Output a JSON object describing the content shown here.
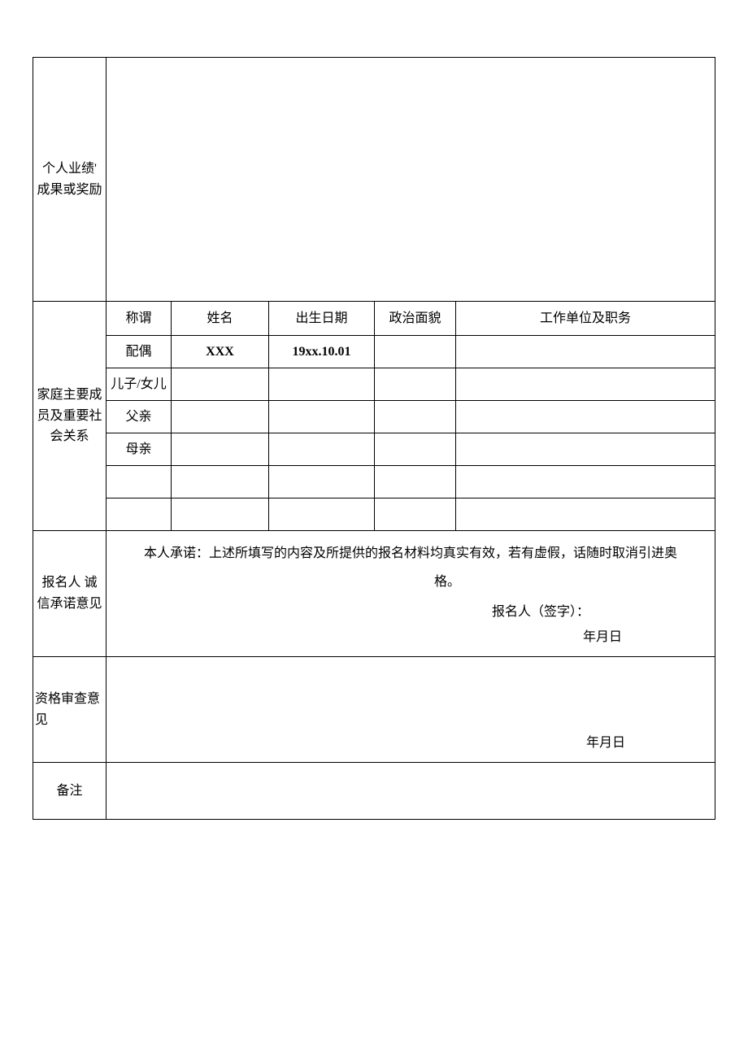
{
  "sections": {
    "achievements_label": "个人业绩' 成果或奖励",
    "family_label": "家庭主要成员及重要社会关系",
    "commitment_label": "报名人 诚信承诺意见",
    "review_label": "资格审查意见",
    "remark_label": "备注"
  },
  "family_headers": {
    "relation": "称谓",
    "name": "姓名",
    "birth": "出生日期",
    "political": "政治面貌",
    "work": "工作单位及职务"
  },
  "family_rows": [
    {
      "relation": "配偶",
      "name": "XXX",
      "birth": "19xx.10.01",
      "political": "",
      "work": ""
    },
    {
      "relation": "儿子/女儿",
      "name": "",
      "birth": "",
      "political": "",
      "work": ""
    },
    {
      "relation": "父亲",
      "name": "",
      "birth": "",
      "political": "",
      "work": ""
    },
    {
      "relation": "母亲",
      "name": "",
      "birth": "",
      "political": "",
      "work": ""
    },
    {
      "relation": "",
      "name": "",
      "birth": "",
      "political": "",
      "work": ""
    },
    {
      "relation": "",
      "name": "",
      "birth": "",
      "political": "",
      "work": ""
    }
  ],
  "commitment": {
    "text_line1": "本人承诺：上述所填写的内容及所提供的报名材料均真实有效，若有虚假，话随时取消引进奥",
    "text_line2": "格。",
    "signature": "报名人（签字）：",
    "date": "年月日"
  },
  "review": {
    "date": "年月日"
  }
}
